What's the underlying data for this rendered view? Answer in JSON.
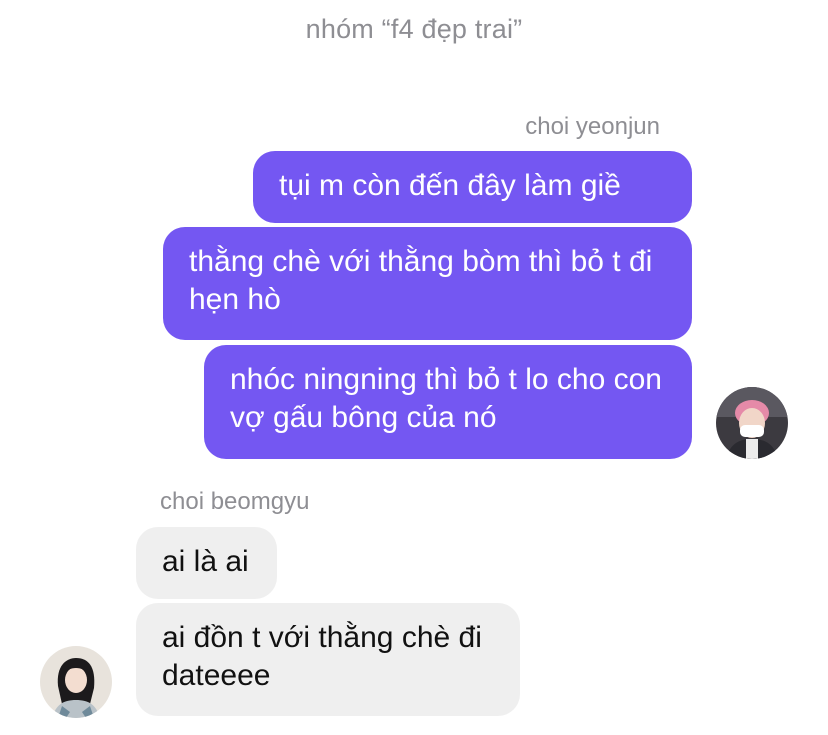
{
  "header": {
    "group_title": "nhóm “f4 đẹp trai”"
  },
  "conversation": {
    "outgoing_sender": "choi yeonjun",
    "incoming_sender": "choi beomgyu",
    "messages": [
      {
        "text": "tụi m còn đến đây làm giề"
      },
      {
        "text": "thằng chè với thằng bòm thì bỏ t đi hẹn hò"
      },
      {
        "text": "nhóc ningning thì bỏ t lo cho con vợ gấu bông của nó"
      },
      {
        "text": "ai là ai"
      },
      {
        "text": "ai đồn t với thằng chè đi dateeee"
      }
    ]
  },
  "colors": {
    "outgoing_bubble": "#7457f2",
    "incoming_bubble": "#efefef",
    "meta_text": "#8e8e93"
  },
  "icons": {
    "outgoing_avatar": "profile-photo-avatar",
    "incoming_avatar": "profile-photo-avatar"
  }
}
